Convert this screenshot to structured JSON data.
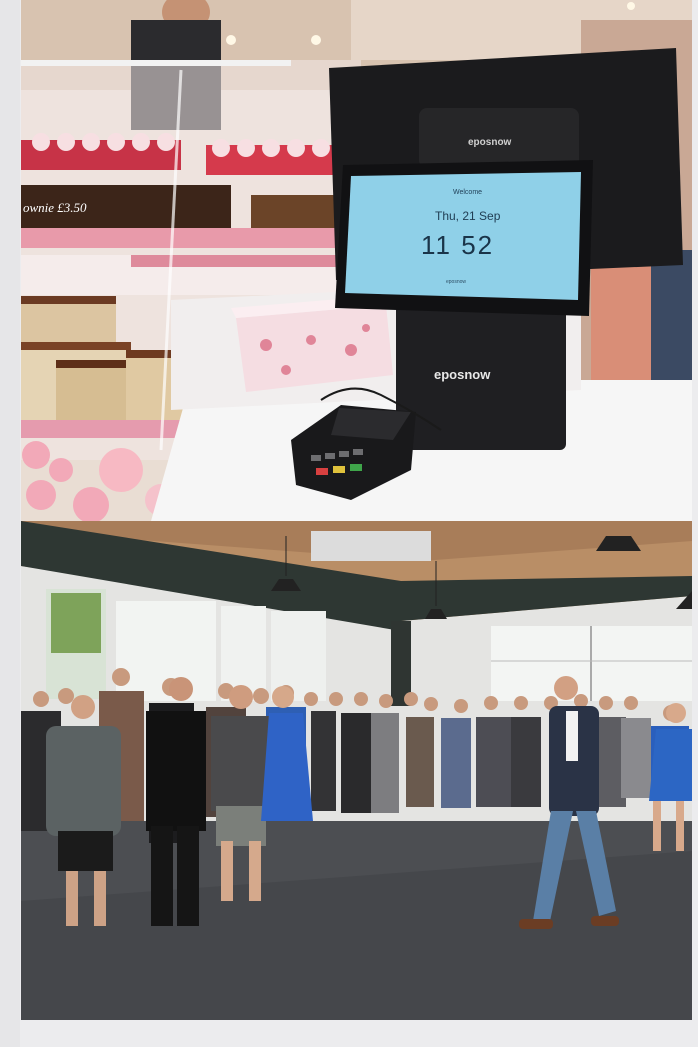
{
  "photos": {
    "top": {
      "brand": "eposnow",
      "screen": {
        "greeting": "Welcome",
        "date": "Thu, 21 Sep",
        "time": "11 52",
        "footer_brand": "eposnow"
      },
      "cake_sign": "ownie £3.50"
    },
    "bottom": {}
  },
  "colors": {
    "screen_bg": "#8fd0e8",
    "terminal": "#1c1c1e",
    "counter": "#f6f6f6",
    "pink_shelf": "#e7a7b4",
    "floor": "#4a4c50",
    "ceiling_wood": "#b98e66",
    "ceiling_beam": "#2e3733"
  }
}
